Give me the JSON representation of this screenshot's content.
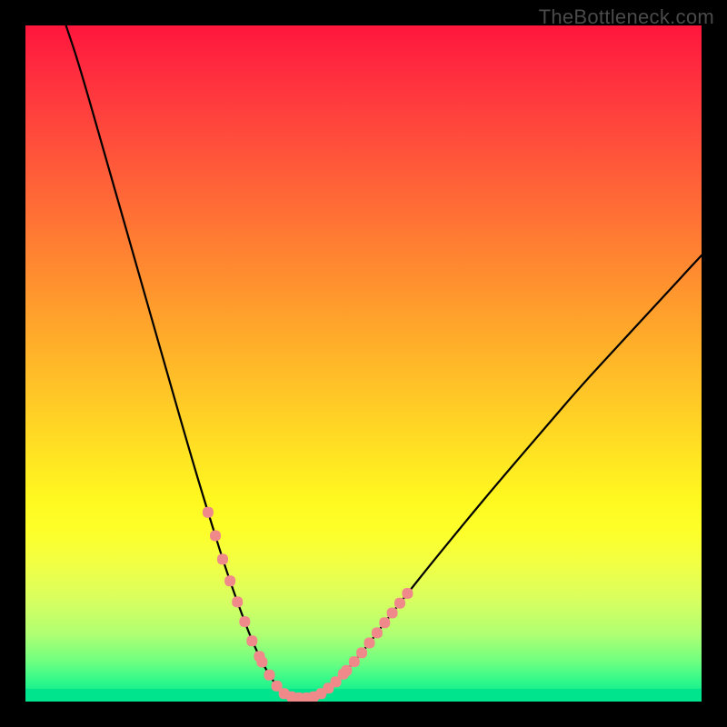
{
  "watermark": "TheBottleneck.com",
  "chart_data": {
    "type": "line",
    "title": "",
    "xlabel": "",
    "ylabel": "",
    "xlim": [
      0,
      100
    ],
    "ylim": [
      0,
      100
    ],
    "grid": false,
    "legend": false,
    "curve_points_pct": [
      {
        "x": 6.0,
        "y": 100.0
      },
      {
        "x": 8.0,
        "y": 94.0
      },
      {
        "x": 12.0,
        "y": 80.0
      },
      {
        "x": 16.0,
        "y": 66.0
      },
      {
        "x": 20.0,
        "y": 52.0
      },
      {
        "x": 24.0,
        "y": 38.0
      },
      {
        "x": 27.0,
        "y": 28.0
      },
      {
        "x": 29.5,
        "y": 20.0
      },
      {
        "x": 31.6,
        "y": 14.0
      },
      {
        "x": 33.5,
        "y": 9.0
      },
      {
        "x": 35.4,
        "y": 5.0
      },
      {
        "x": 37.0,
        "y": 2.5
      },
      {
        "x": 38.2,
        "y": 1.2
      },
      {
        "x": 39.6,
        "y": 0.6
      },
      {
        "x": 41.0,
        "y": 0.5
      },
      {
        "x": 42.4,
        "y": 0.6
      },
      {
        "x": 43.8,
        "y": 1.2
      },
      {
        "x": 45.5,
        "y": 2.5
      },
      {
        "x": 47.5,
        "y": 4.6
      },
      {
        "x": 50.0,
        "y": 7.5
      },
      {
        "x": 53.0,
        "y": 11.5
      },
      {
        "x": 56.5,
        "y": 16.0
      },
      {
        "x": 60.5,
        "y": 21.0
      },
      {
        "x": 65.0,
        "y": 26.5
      },
      {
        "x": 70.0,
        "y": 32.5
      },
      {
        "x": 76.0,
        "y": 39.5
      },
      {
        "x": 82.0,
        "y": 46.5
      },
      {
        "x": 88.0,
        "y": 53.0
      },
      {
        "x": 94.0,
        "y": 59.5
      },
      {
        "x": 100.0,
        "y": 66.0
      }
    ],
    "marker_cluster_ranges_x_pct": [
      {
        "start": 27.0,
        "end": 34.6,
        "count": 8
      },
      {
        "start": 35.0,
        "end": 47.0,
        "count": 12
      },
      {
        "start": 47.5,
        "end": 56.5,
        "count": 9
      }
    ],
    "colors": {
      "curve": "#000000",
      "markers": "#f08a8a",
      "background_top": "#ff163c",
      "background_bottom": "#00e690"
    }
  }
}
